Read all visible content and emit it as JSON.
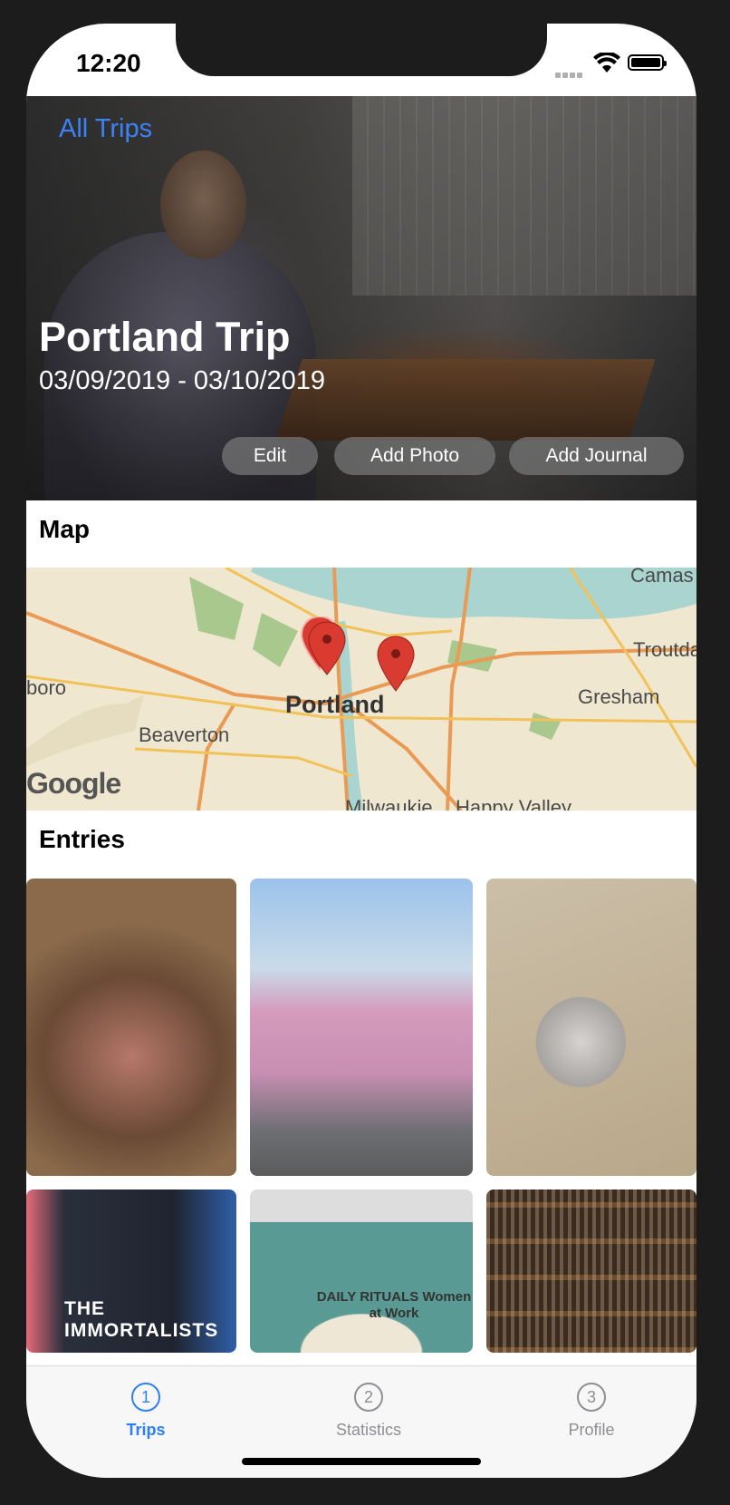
{
  "status": {
    "time": "12:20"
  },
  "header": {
    "back_label": "All Trips",
    "title": "Portland Trip",
    "dates": "03/09/2019 - 03/10/2019"
  },
  "actions": {
    "edit_label": "Edit",
    "add_photo_label": "Add Photo",
    "add_journal_label": "Add Journal"
  },
  "map": {
    "section_title": "Map",
    "labels": {
      "camas": "Camas",
      "troutdale": "Troutda",
      "boro": "boro",
      "portland": "Portland",
      "gresham": "Gresham",
      "beaverton": "Beaverton",
      "milwaukie": "Milwaukie",
      "happy_valley": "Happy Valley"
    },
    "attribution": "Google",
    "pin_color": "#d93b30"
  },
  "entries": {
    "section_title": "Entries",
    "items": [
      {
        "photo": "sandwich-photo"
      },
      {
        "photo": "pink-food-truck-photo"
      },
      {
        "photo": "donut-photo"
      },
      {
        "photo": "book-immortalists-photo",
        "caption": "THE IMMORTALISTS"
      },
      {
        "photo": "book-daily-rituals-photo",
        "caption": "DAILY RITUALS Women at Work"
      },
      {
        "photo": "bookshelf-photo"
      }
    ]
  },
  "tabbar": {
    "tabs": [
      {
        "icon": "1",
        "label": "Trips",
        "active": true
      },
      {
        "icon": "2",
        "label": "Statistics",
        "active": false
      },
      {
        "icon": "3",
        "label": "Profile",
        "active": false
      }
    ],
    "accent": "#2d7ff9"
  },
  "link_color": "#3b82f6"
}
